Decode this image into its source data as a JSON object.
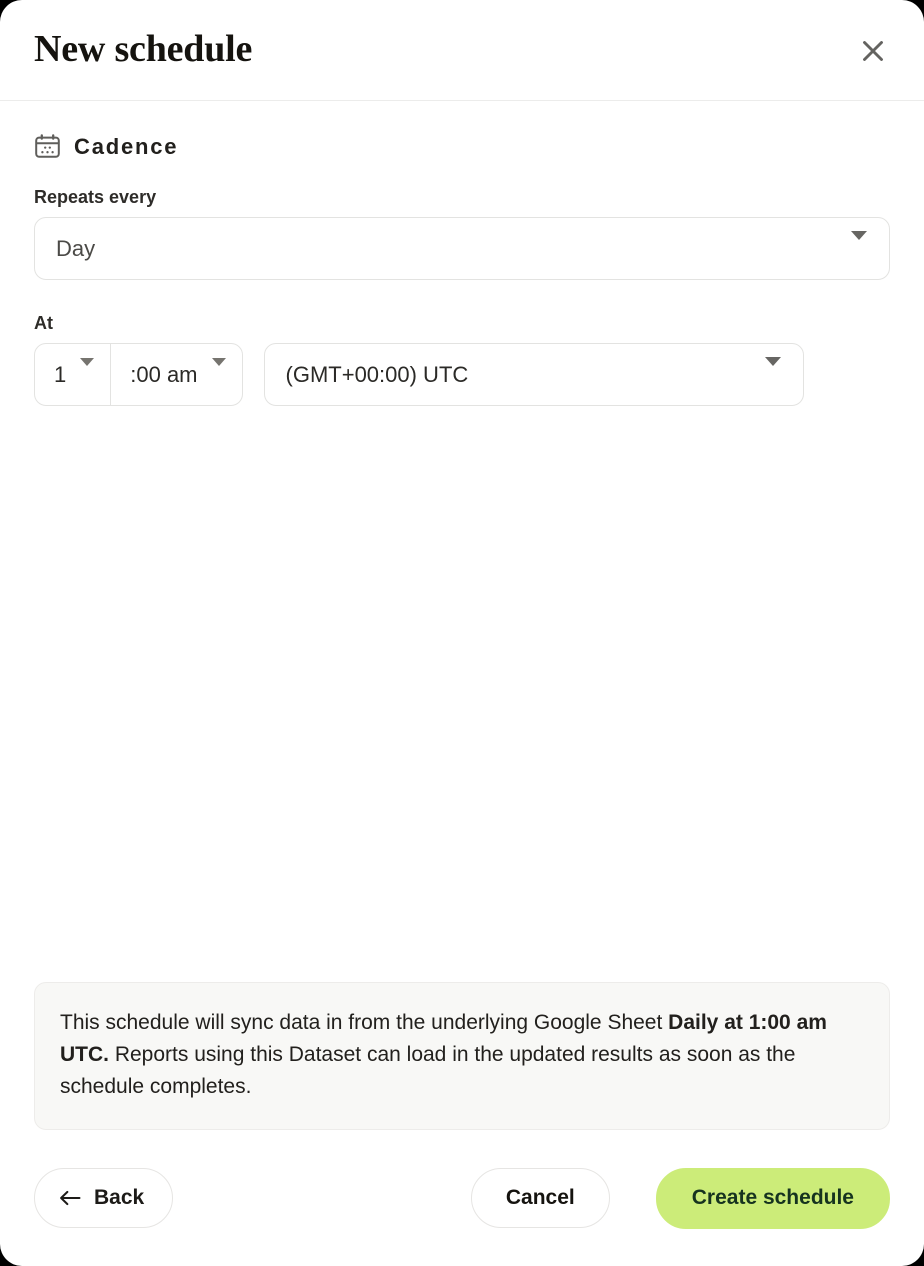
{
  "dialog": {
    "title": "New schedule",
    "close_icon": "close-icon"
  },
  "section": {
    "icon": "calendar-icon",
    "title": "Cadence"
  },
  "fields": {
    "repeats_label": "Repeats every",
    "repeats_value": "Day",
    "at_label": "At",
    "hour_value": "1",
    "minute_value": ":00 am",
    "timezone_value": "(GMT+00:00) UTC"
  },
  "info": {
    "text_before": "This schedule will sync data in from the underlying Google Sheet ",
    "text_bold": "Daily at 1:00 am UTC.",
    "text_after": " Reports using this Dataset can load in the updated results as soon as the schedule completes."
  },
  "footer": {
    "back_label": "Back",
    "back_icon": "arrow-left-icon",
    "cancel_label": "Cancel",
    "create_label": "Create schedule"
  },
  "colors": {
    "accent": "#ccec79",
    "accent_text": "#16331f",
    "border": "#e3e3e1",
    "info_bg": "#f8f8f6",
    "text": "#22201d"
  }
}
